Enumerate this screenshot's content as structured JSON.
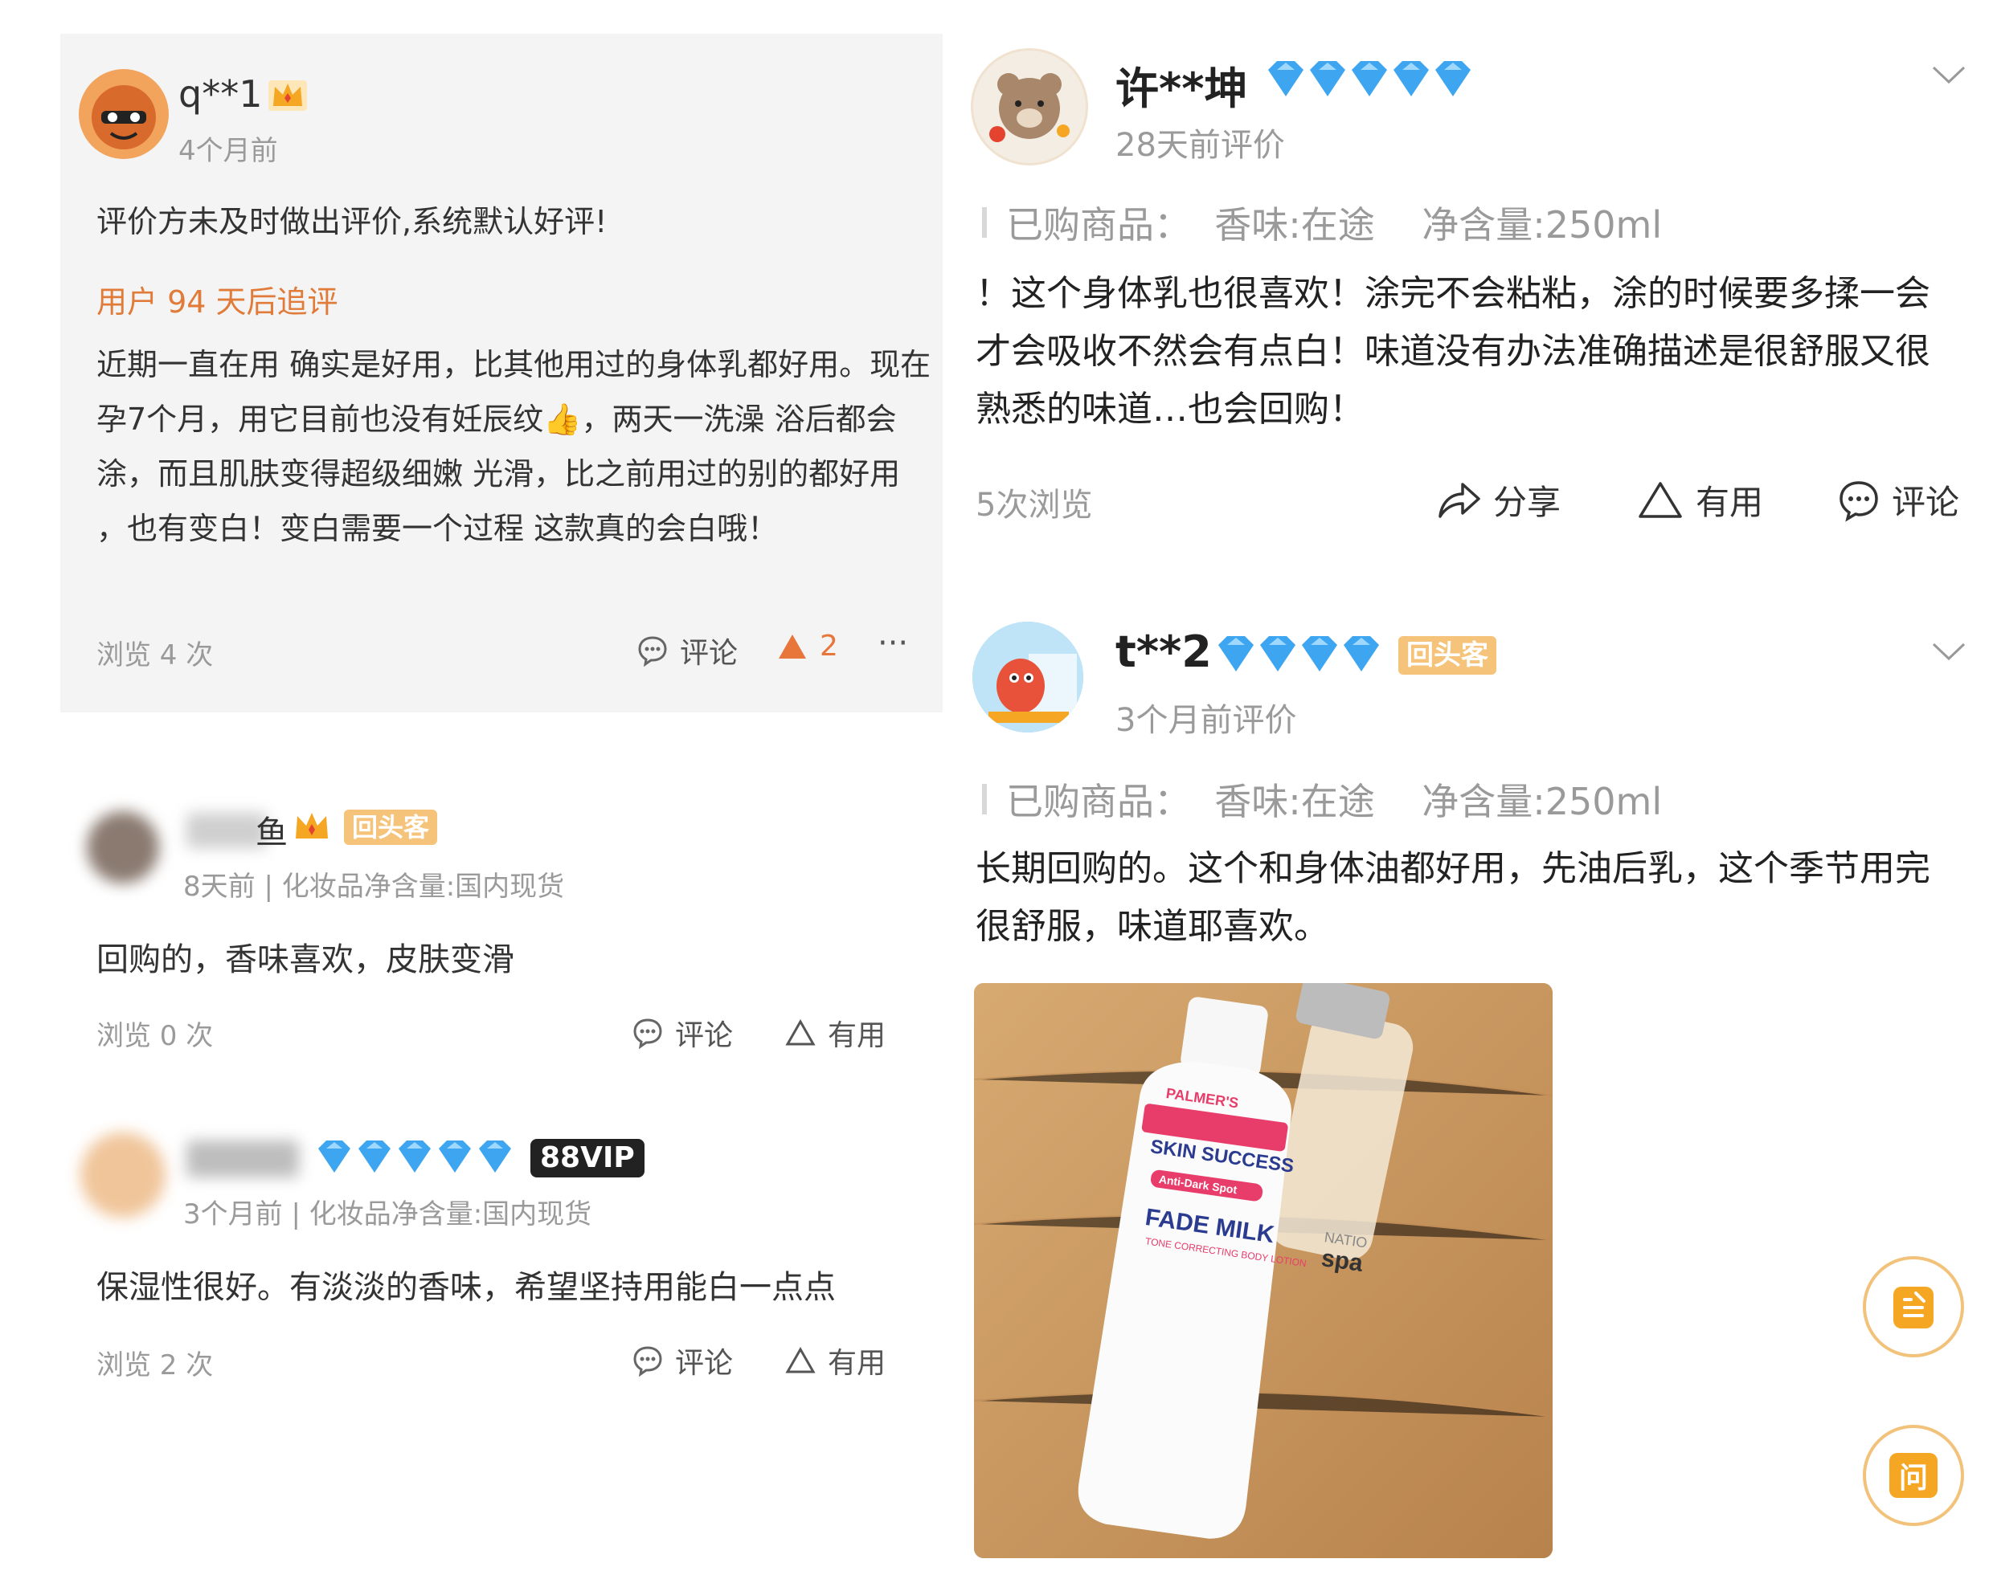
{
  "colors": {
    "accent_orange": "#e8763a",
    "followup_orange": "#e07b39",
    "diamond_blue": "#3ea6f0",
    "muted_gray": "#9a9a9a",
    "card_bg": "#f4f4f4",
    "tag_bg": "#f6c37a"
  },
  "left": {
    "r1": {
      "user": "q**1",
      "time": "4个月前",
      "default_text": "评价方未及时做出评价,系统默认好评!",
      "followup_label": "用户 94 天后追评",
      "followup_text": "近期一直在用 确实是好用，比其他用过的身体乳都好用。现在孕7个月，用它目前也没有妊辰纹👍，两天一洗澡 浴后都会涂，而且肌肤变得超级细嫩 光滑，比之前用过的别的都好用 ，也有变白！变白需要一个过程 这款真的会白哦！",
      "views": "浏览 4 次",
      "comment": "评论",
      "likes": "2",
      "more": "···"
    },
    "r2": {
      "user_tail": "鱼",
      "tag": "回头客",
      "meta": "8天前 | 化妆品净含量:国内现货",
      "text": "回购的，香味喜欢，皮肤变滑",
      "views": "浏览 0 次",
      "comment": "评论",
      "useful": "有用"
    },
    "r3": {
      "tag": "88VIP",
      "meta": "3个月前 | 化妆品净含量:国内现货",
      "text": "保湿性很好。有淡淡的香味，希望坚持用能白一点点",
      "views": "浏览 2 次",
      "comment": "评论",
      "useful": "有用"
    }
  },
  "right": {
    "r1": {
      "user": "许**坤",
      "time": "28天前评价",
      "product": "已购商品：  香味:在途    净含量:250ml",
      "text": "！这个身体乳也很喜欢！涂完不会粘粘，涂的时候要多揉一会才会吸收不然会有点白！味道没有办法准确描述是很舒服又很熟悉的味道…也会回购！",
      "views": "5次浏览",
      "share": "分享",
      "useful": "有用",
      "comment": "评论"
    },
    "r2": {
      "user": "t**2",
      "tag": "回头客",
      "time": "3个月前评价",
      "product": "已购商品：  香味:在途    净含量:250ml",
      "text": "长期回购的。这个和身体油都好用，先油后乳，这个季节用完很舒服，味道耶喜欢。",
      "photo": {
        "brand": "PALMER'S",
        "line": "SKIN SUCCESS",
        "sub": "Anti-Dark Spot",
        "name": "FADE MILK",
        "desc": "TONE CORRECTING BODY LOTION",
        "bottle2_brand": "NATIO",
        "bottle2_name": "spa"
      },
      "float_ask": "问"
    }
  }
}
